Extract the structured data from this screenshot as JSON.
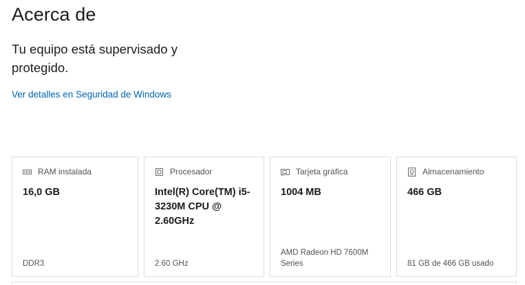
{
  "page": {
    "title": "Acerca de",
    "protection_status": "Tu equipo está supervisado y protegido.",
    "security_link": "Ver detalles en Seguridad de Windows"
  },
  "specs": [
    {
      "icon": "ram-icon",
      "label": "RAM instalada",
      "value": "16,0 GB",
      "detail": "DDR3"
    },
    {
      "icon": "processor-icon",
      "label": "Procesador",
      "value": "Intel(R) Core(TM) i5-3230M CPU @ 2.60GHz",
      "detail": "2.60 GHz"
    },
    {
      "icon": "graphics-card-icon",
      "label": "Tarjeta gráfica",
      "value": "1004 MB",
      "detail": "AMD Radeon HD 7600M Series"
    },
    {
      "icon": "storage-icon",
      "label": "Almacenamiento",
      "value": "466 GB",
      "detail": "81 GB de 466 GB usado"
    }
  ],
  "colors": {
    "link": "#0063b1",
    "card_border": "#dedede"
  }
}
